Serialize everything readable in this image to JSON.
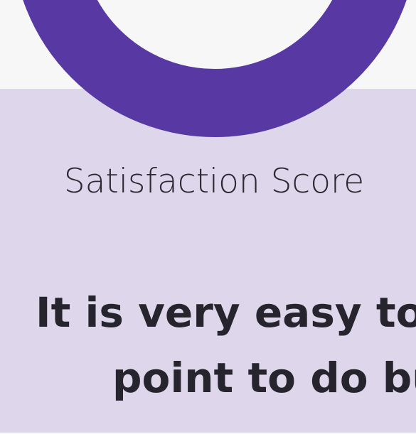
{
  "score": {
    "label": "Satisfaction Score",
    "ring_color": "#5839a3"
  },
  "quote": {
    "line1": "It is very easy to",
    "line2": "point to do bu"
  },
  "colors": {
    "background": "#f7f7f8",
    "card": "#ded7eb",
    "text": "#26252e"
  }
}
